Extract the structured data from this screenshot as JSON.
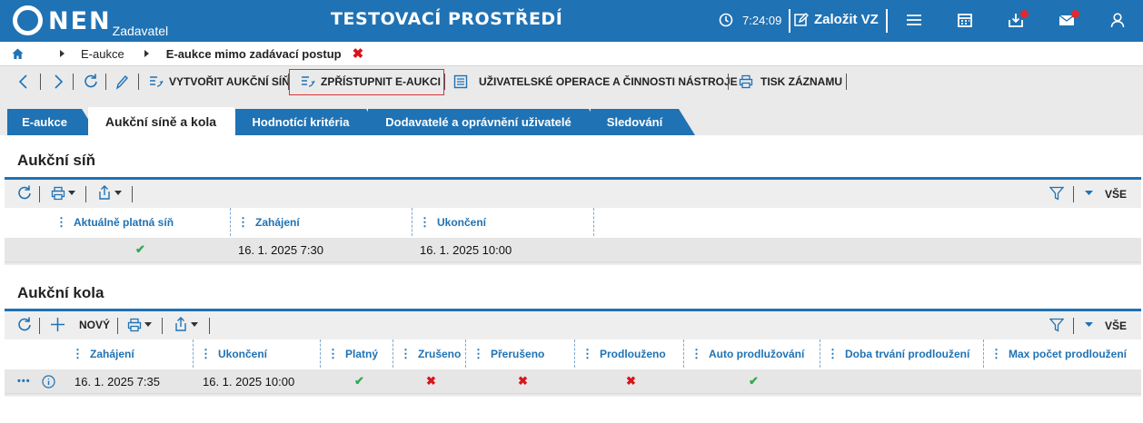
{
  "header": {
    "logo_text": "NEN",
    "logo_sub": "Zadavatel",
    "title": "TESTOVACÍ PROSTŘEDÍ",
    "time": "7:24:09",
    "create_label": "Založit VZ",
    "colors": {
      "primary": "#1f72b4",
      "notification": "#e0282e"
    },
    "icons": [
      "clock-icon",
      "edit-icon",
      "menu-icon",
      "calendar-icon",
      "inbox-icon",
      "mail-icon",
      "user-icon"
    ]
  },
  "breadcrumb": {
    "items": [
      "E-aukce",
      "E-aukce mimo zadávací postup"
    ]
  },
  "toolbar": {
    "create_hall": "VYTVOŘIT AUKČNÍ SÍŇ",
    "publish": "ZPŘÍSTUPNIT E-AUKCI",
    "user_ops": "UŽIVATELSKÉ OPERACE A ČINNOSTI NÁSTROJE",
    "print": "TISK ZÁZNAMU"
  },
  "tabs": [
    {
      "label": "E-aukce"
    },
    {
      "label": "Aukční síně a kola",
      "active": true
    },
    {
      "label": "Hodnotící kritéria"
    },
    {
      "label": "Dodavatelé a oprávnění uživatelé"
    },
    {
      "label": "Sledování"
    }
  ],
  "hall": {
    "title": "Aukční síň",
    "filter_all": "VŠE",
    "columns": [
      "Aktuálně platná síň",
      "Zahájení",
      "Ukončení"
    ],
    "rows": [
      {
        "valid": "✔",
        "start": "16. 1. 2025 7:30",
        "end": "16. 1. 2025 10:00"
      }
    ]
  },
  "rounds": {
    "title": "Aukční kola",
    "new_label": "NOVÝ",
    "filter_all": "VŠE",
    "columns": [
      "Zahájení",
      "Ukončení",
      "Platný",
      "Zrušeno",
      "Přerušeno",
      "Prodlouženo",
      "Auto prodlužování",
      "Doba trvání prodloužení",
      "Max počet prodloužení"
    ],
    "rows": [
      {
        "start": "16. 1. 2025 7:35",
        "end": "16. 1. 2025 10:00",
        "valid": "✔",
        "cancelled": "✖",
        "interrupted": "✖",
        "extended": "✖",
        "auto_extend": "✔",
        "extend_duration": "",
        "max_extensions": ""
      }
    ]
  }
}
